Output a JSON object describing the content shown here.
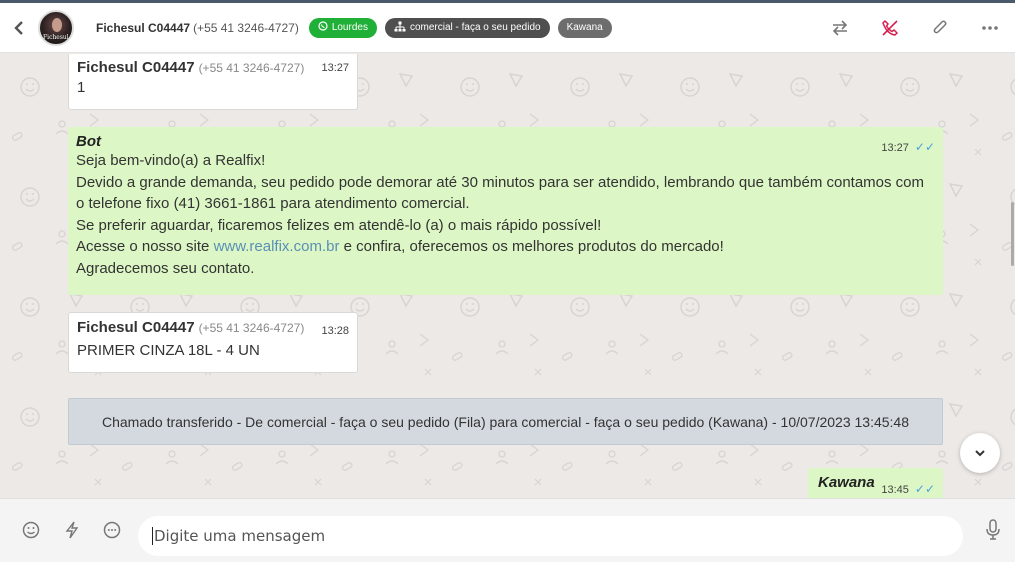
{
  "header": {
    "back_icon": "chevron-left-icon",
    "contact_name": "Fichesul C04447",
    "contact_phone": "(+55 41 3246-4727)",
    "avatar_label": "Fichesul",
    "tags": [
      {
        "label": "Lourdes",
        "icon": "whatsapp-icon",
        "color": "#20b038"
      },
      {
        "label": "comercial - faça o seu pedido",
        "icon": "org-chart-icon",
        "color": "#4f4f4f"
      },
      {
        "label": "Kawana",
        "color": "#6d6d6d"
      }
    ],
    "actions": [
      "transfer-icon",
      "end-call-icon",
      "paperclip-icon",
      "more-icon"
    ]
  },
  "messages": {
    "m1": {
      "sender": "Fichesul C04447",
      "phone": "(+55 41 3246-4727)",
      "time": "13:27",
      "text": "1"
    },
    "bot": {
      "sender": "Bot",
      "time": "13:27",
      "lines": [
        "Seja bem-vindo(a) a Realfix!",
        "Devido a grande demanda, seu pedido pode demorar até 30 minutos para ser atendido, lembrando que também contamos com o telefone fixo (41) 3661-1861 para atendimento comercial.",
        "Se preferir aguardar, ficaremos felizes em atendê-lo (a) o mais rápido possível!"
      ],
      "site_prefix": "Acesse o nosso site ",
      "site_link": "www.realfix.com.br",
      "site_suffix": " e confira, oferecemos os melhores produtos do mercado!",
      "last_line": "Agradecemos seu contato."
    },
    "m3": {
      "sender": "Fichesul C04447",
      "phone": "(+55 41 3246-4727)",
      "time": "13:28",
      "text": "PRIMER CINZA 18L - 4 UN"
    },
    "system": "Chamado transferido - De comercial - faça o seu pedido (Fila) para comercial - faça o seu pedido (Kawana) - 10/07/2023 13:45:48",
    "m5": {
      "sender": "Kawana",
      "time": "13:45"
    }
  },
  "composer": {
    "placeholder": "Digite uma mensagem",
    "icons": [
      "emoji-icon",
      "lightning-icon",
      "quick-reply-icon",
      "microphone-icon"
    ]
  },
  "colors": {
    "outgoing_bubble": "#dcf7c5",
    "accent_green": "#20b038",
    "end_call_red": "#d6204e",
    "system_bg": "#d4d9e0"
  }
}
